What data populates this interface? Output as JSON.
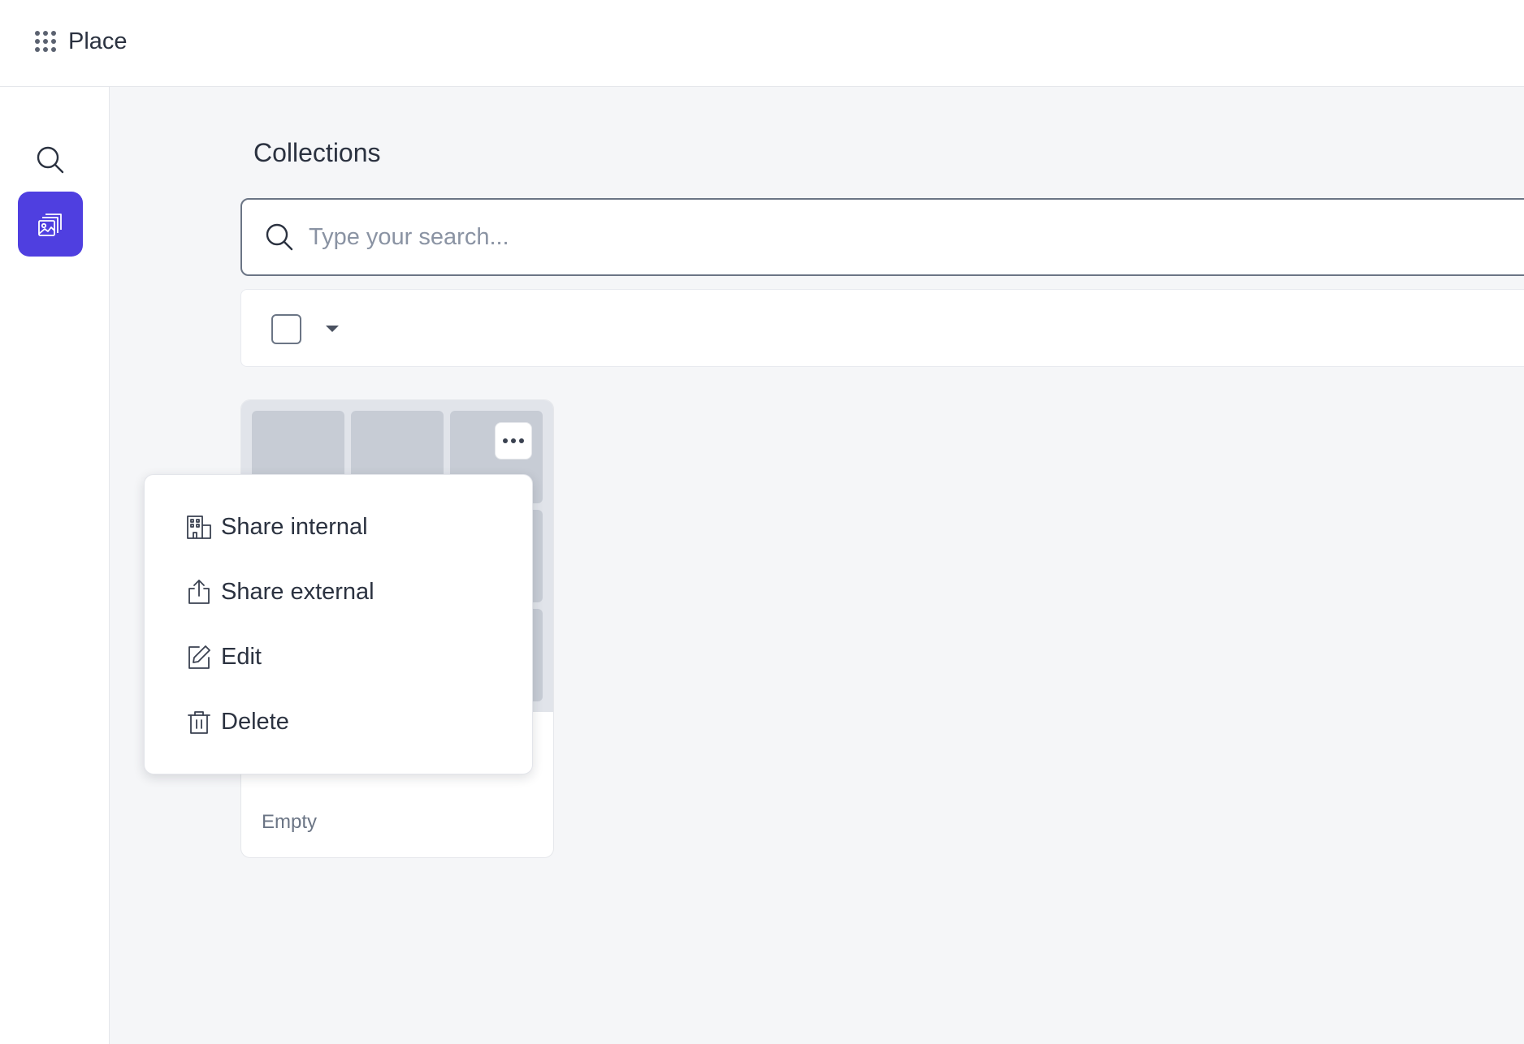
{
  "app": {
    "title": "Place",
    "apps_icon": "apps-grid-icon"
  },
  "sidebar": {
    "items": [
      {
        "name": "search",
        "icon": "search-icon",
        "active": false
      },
      {
        "name": "collections",
        "icon": "collections-icon",
        "active": true
      }
    ],
    "accent_color": "#4f3fe0"
  },
  "main": {
    "title": "Collections",
    "search": {
      "placeholder": "Type your search...",
      "value": ""
    },
    "toolbar": {
      "select_all_checked": false,
      "select_caret_icon": "caret-down-icon"
    },
    "collections": [
      {
        "status": "Empty",
        "more_icon": "more-horizontal-icon"
      }
    ]
  },
  "context_menu": {
    "items": [
      {
        "label": "Share internal",
        "icon": "building-icon"
      },
      {
        "label": "Share external",
        "icon": "share-upload-icon"
      },
      {
        "label": "Edit",
        "icon": "edit-icon"
      },
      {
        "label": "Delete",
        "icon": "trash-icon"
      }
    ]
  }
}
